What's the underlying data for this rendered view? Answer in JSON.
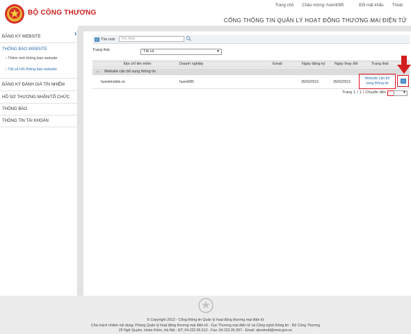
{
  "header": {
    "brand": "BỘ CÔNG THƯƠNG",
    "portal_title": "CỔNG THÔNG TIN QUẢN LÝ HOẠT ĐỘNG THƯƠNG MẠI ĐIỆN TỬ",
    "links": {
      "home": "Trang chủ",
      "greeting": "Chào mừng: hunnt085",
      "change_password": "Đổi mật khẩu",
      "logout": "Thoát"
    }
  },
  "sidebar": {
    "items": [
      {
        "label": "ĐĂNG KÝ WEBSITE"
      },
      {
        "label": "THÔNG BÁO WEBSITE"
      },
      {
        "label": "Thêm mới thông báo website"
      },
      {
        "label": "Tất cả HS thông báo website"
      },
      {
        "label": "ĐĂNG KÝ ĐÁNH GIÁ TÍN NHIỆM"
      },
      {
        "label": "HỒ SƠ THƯƠNG NHÂN/TỔ CHỨC"
      },
      {
        "label": "THÔNG BÁO"
      },
      {
        "label": "THÔNG TIN TÀI KHOẢN"
      }
    ],
    "collapse_glyph": "›"
  },
  "toolbar": {
    "search_label": "Tìm mới",
    "search_placeholder": "Tên Web"
  },
  "filter": {
    "label": "Trạng thái",
    "value": "Tất cả",
    "arrow": "▼"
  },
  "grid": {
    "columns": [
      "Địa chỉ tên miền",
      "Doanh nghiệp",
      "Email",
      "Ngày đăng ký",
      "Ngày thay đổi",
      "Trạng thái"
    ],
    "group_label": "Website cần bổ sung thông tin",
    "group_chevron": "⌄",
    "rows": [
      {
        "domain": "hunnitmobile.vn",
        "company": "hunnt085",
        "email": "",
        "registered": "26/02/2013",
        "changed": "26/02/2013",
        "status_line1": "Website cần bổ",
        "status_line2": "sung thông tin"
      }
    ]
  },
  "pager": {
    "prefix": "Trang",
    "current": "1",
    "sep": "/",
    "total": "1",
    "jump_label": "Chuyển đến",
    "arrow": "▼"
  },
  "footer": {
    "line1": "© Copyright 2013 - Cổng thông tin Quản lý hoạt động thương mại điện tử",
    "line2": "Chịu trách nhiệm nội dung: Phòng Quản lý hoạt động thương mại điện tử - Cục Thương mại điện tử và Công nghệ thông tin - Bộ Công Thương",
    "line3": "25 Ngô Quyền, Hoàn Kiếm, Hà Nội - ĐT: 04.222.05.512 - Fax: 04.222.05.397 - Email: qlwstmdt@moit.gov.vn"
  },
  "colors": {
    "brand_red": "#c9201f",
    "link_blue": "#2a6bb0",
    "highlight_red": "#dd1122"
  }
}
